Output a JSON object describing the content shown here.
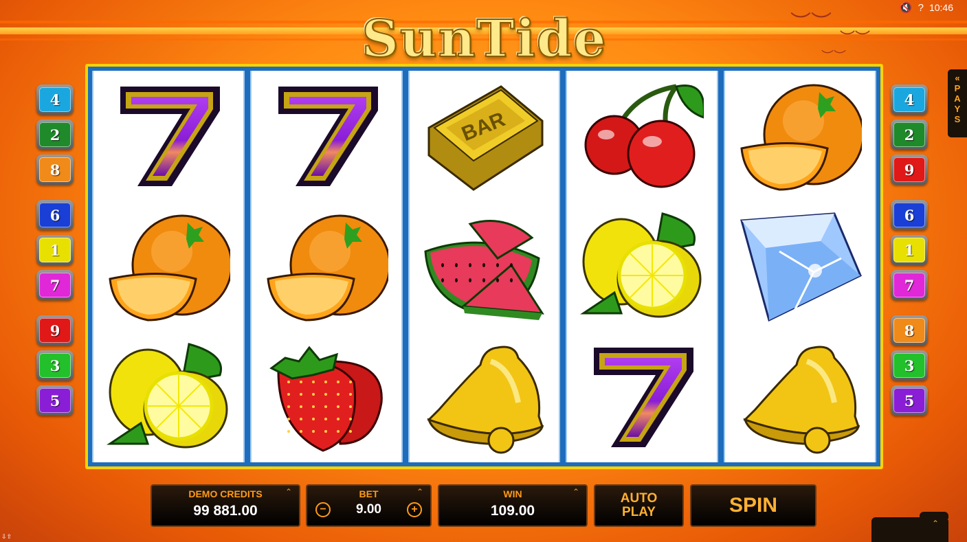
{
  "status": {
    "mute_icon": "speaker-muted-icon",
    "help_icon": "question-icon",
    "clock": "10:46"
  },
  "logo": {
    "text": "SunTide"
  },
  "line_numbers": {
    "left": [
      {
        "n": "4",
        "color": "#1aa7e0"
      },
      {
        "n": "2",
        "color": "#1e8a2a"
      },
      {
        "n": "8",
        "color": "#f08a18"
      },
      {
        "n": "6",
        "color": "#1a3fd6"
      },
      {
        "n": "1",
        "color": "#e8e000"
      },
      {
        "n": "7",
        "color": "#e028d8"
      },
      {
        "n": "9",
        "color": "#e01818"
      },
      {
        "n": "3",
        "color": "#22c02a"
      },
      {
        "n": "5",
        "color": "#8a1ed6"
      }
    ],
    "right": [
      {
        "n": "4",
        "color": "#1aa7e0"
      },
      {
        "n": "2",
        "color": "#1e8a2a"
      },
      {
        "n": "9",
        "color": "#e01818"
      },
      {
        "n": "6",
        "color": "#1a3fd6"
      },
      {
        "n": "1",
        "color": "#e8e000"
      },
      {
        "n": "7",
        "color": "#e028d8"
      },
      {
        "n": "8",
        "color": "#f08a18"
      },
      {
        "n": "3",
        "color": "#22c02a"
      },
      {
        "n": "5",
        "color": "#8a1ed6"
      }
    ]
  },
  "reels": [
    [
      "seven",
      "orange",
      "lemon"
    ],
    [
      "seven",
      "orange",
      "strawberry"
    ],
    [
      "bar",
      "watermelon",
      "bell"
    ],
    [
      "cherry",
      "lemon",
      "seven"
    ],
    [
      "orange",
      "diamond",
      "bell"
    ]
  ],
  "bar_symbol_text": "BAR",
  "pays_tab": {
    "arrow": "«",
    "letters": [
      "P",
      "A",
      "Y",
      "S"
    ]
  },
  "controls": {
    "credits": {
      "label": "DEMO CREDITS",
      "value": "99 881.00"
    },
    "bet": {
      "label": "BET",
      "value": "9.00",
      "minus": "−",
      "plus": "+"
    },
    "win": {
      "label": "WIN",
      "value": "109.00"
    },
    "autoplay": {
      "line1": "AUTO",
      "line2": "PLAY"
    },
    "spin": {
      "label": "SPIN"
    },
    "expand_arrow": "⌃"
  },
  "colors": {
    "accent": "#ff9b1a",
    "reel_frame": "#1e6dbd",
    "frame_border": "#ffd200"
  }
}
